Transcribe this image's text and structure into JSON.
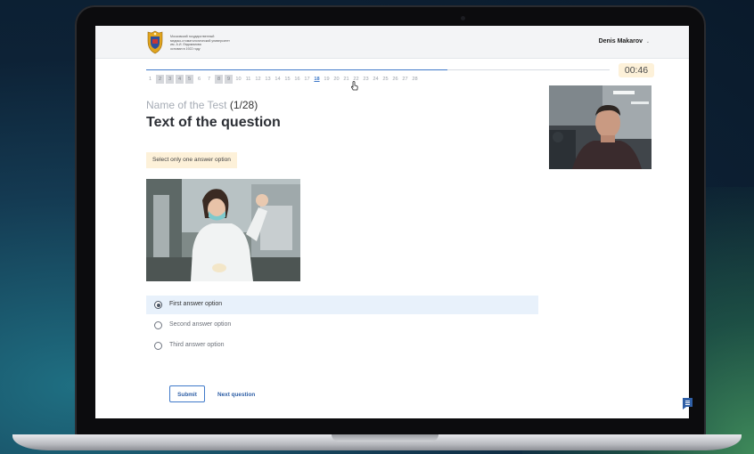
{
  "header": {
    "org_lines": [
      "Московский государственный",
      "медико-стоматологический университет",
      "им. А.И. Евдокимова",
      "основан в 1922 году"
    ],
    "user_name": "Denis Makarov"
  },
  "timer": "00:46",
  "progress": {
    "current_question": 18,
    "total": 28,
    "bar_fraction": 0.65
  },
  "question_nav": [
    {
      "n": "1",
      "s": ""
    },
    {
      "n": "2",
      "s": "done"
    },
    {
      "n": "3",
      "s": "done"
    },
    {
      "n": "4",
      "s": "done"
    },
    {
      "n": "5",
      "s": "done"
    },
    {
      "n": "6",
      "s": ""
    },
    {
      "n": "7",
      "s": ""
    },
    {
      "n": "8",
      "s": "done"
    },
    {
      "n": "9",
      "s": "done"
    },
    {
      "n": "10",
      "s": ""
    },
    {
      "n": "11",
      "s": ""
    },
    {
      "n": "12",
      "s": ""
    },
    {
      "n": "13",
      "s": ""
    },
    {
      "n": "14",
      "s": ""
    },
    {
      "n": "15",
      "s": ""
    },
    {
      "n": "16",
      "s": ""
    },
    {
      "n": "17",
      "s": ""
    },
    {
      "n": "18",
      "s": "cur"
    },
    {
      "n": "19",
      "s": ""
    },
    {
      "n": "20",
      "s": ""
    },
    {
      "n": "21",
      "s": ""
    },
    {
      "n": "22",
      "s": ""
    },
    {
      "n": "23",
      "s": ""
    },
    {
      "n": "24",
      "s": ""
    },
    {
      "n": "25",
      "s": ""
    },
    {
      "n": "26",
      "s": ""
    },
    {
      "n": "27",
      "s": ""
    },
    {
      "n": "28",
      "s": ""
    }
  ],
  "test": {
    "name": "Name of the Test",
    "count": "(1/28)"
  },
  "question_text": "Text of the question",
  "hint": "Select only one answer option",
  "answers": [
    {
      "label": "First answer option",
      "selected": true
    },
    {
      "label": "Second answer option",
      "selected": false
    },
    {
      "label": "Third answer option",
      "selected": false
    }
  ],
  "buttons": {
    "submit": "Submit",
    "next": "Next question"
  },
  "colors": {
    "accent": "#3f79c9",
    "timer_bg": "#fdf1d9",
    "selected_bg": "#e8f1fb"
  }
}
